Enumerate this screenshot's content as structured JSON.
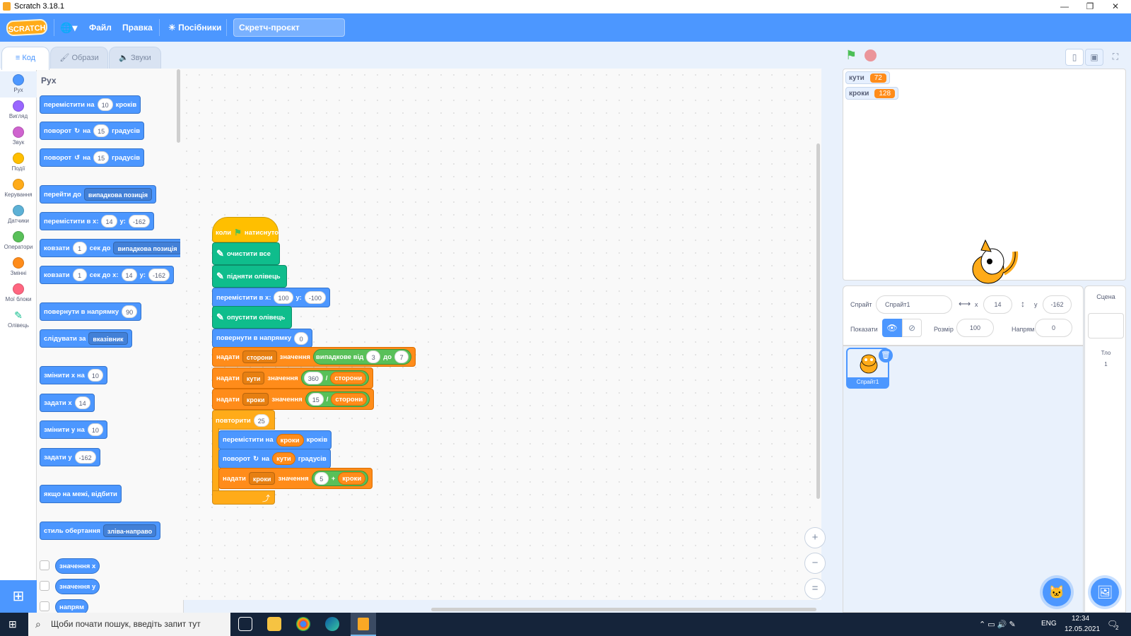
{
  "window": {
    "title": "Scratch 3.18.1",
    "minimize": "—",
    "restore": "❐",
    "close": "✕"
  },
  "menubar": {
    "logo": "SCRATCH",
    "language_icon": "🌐▾",
    "file": "Файл",
    "edit": "Правка",
    "tutorials": "Посібники",
    "project_title": "Скретч-проєкт"
  },
  "tabs": {
    "code": "Код",
    "costumes": "Образи",
    "sounds": "Звуки"
  },
  "categories": [
    {
      "label": "Рух",
      "color": "#4c97ff"
    },
    {
      "label": "Вигляд",
      "color": "#9966ff"
    },
    {
      "label": "Звук",
      "color": "#cf63cf"
    },
    {
      "label": "Події",
      "color": "#ffbf00"
    },
    {
      "label": "Керування",
      "color": "#ffab19"
    },
    {
      "label": "Датчики",
      "color": "#5cb1d6"
    },
    {
      "label": "Оператори",
      "color": "#59c059"
    },
    {
      "label": "Змінні",
      "color": "#ff8c1a"
    },
    {
      "label": "Мої блоки",
      "color": "#ff6680"
    },
    {
      "label": "Олівець",
      "color": "#0fbd8c"
    }
  ],
  "palette": {
    "title": "Рух",
    "move": {
      "a": "перемістити на",
      "n": "10",
      "b": "кроків"
    },
    "turn_cw": {
      "a": "поворот",
      "b": "на",
      "n": "15",
      "c": "градусів"
    },
    "turn_ccw": {
      "a": "поворот",
      "b": "на",
      "n": "15",
      "c": "градусів"
    },
    "goto": {
      "a": "перейти до",
      "dd": "випадкова позиція"
    },
    "goto_xy": {
      "a": "перемістити в x:",
      "x": "14",
      "b": "y:",
      "y": "-162"
    },
    "glide": {
      "a": "ковзати",
      "n": "1",
      "b": "сек до",
      "dd": "випадкова позиція"
    },
    "glide_xy": {
      "a": "ковзати",
      "n": "1",
      "b": "сек до x:",
      "x": "14",
      "c": "y:",
      "y": "-162"
    },
    "point_dir": {
      "a": "повернути в напрямку",
      "n": "90"
    },
    "point_towards": {
      "a": "слідувати за",
      "dd": "вказівник"
    },
    "change_x": {
      "a": "змінити х на",
      "n": "10"
    },
    "set_x": {
      "a": "задати х",
      "n": "14"
    },
    "change_y": {
      "a": "змінити у на",
      "n": "10"
    },
    "set_y": {
      "a": "задати у",
      "n": "-162"
    },
    "bounce": "якщо на межі, відбити",
    "rotation_style": {
      "a": "стиль обертання",
      "dd": "зліва-направо"
    },
    "rep_x": "значення x",
    "rep_y": "значення y",
    "rep_dir": "напрям"
  },
  "script": {
    "hat": {
      "a": "коли",
      "b": "натиснуто"
    },
    "clear": "очистити все",
    "pen_up": "підняти олівець",
    "goto_xy": {
      "a": "перемістити в x:",
      "x": "100",
      "b": "у:",
      "y": "-100"
    },
    "pen_down": "опустити олівець",
    "point_dir": {
      "a": "повернути в напрямку",
      "n": "0"
    },
    "set_sides": {
      "a": "надати",
      "dd": "сторони",
      "b": "значення",
      "c": "випадкове від",
      "n1": "3",
      "d": "до",
      "n2": "7"
    },
    "set_angles": {
      "a": "надати",
      "dd": "кути",
      "b": "значення",
      "n": "360",
      "op": "/",
      "v": "сторони"
    },
    "set_steps": {
      "a": "надати",
      "dd": "кроки",
      "b": "значення",
      "n": "15",
      "op": "/",
      "v": "сторони"
    },
    "repeat": {
      "a": "повторити",
      "n": "25"
    },
    "inner_move": {
      "a": "перемістити на",
      "v": "кроки",
      "b": "кроків"
    },
    "inner_turn": {
      "a": "поворот",
      "b": "на",
      "v": "кути",
      "c": "градусів"
    },
    "inner_set": {
      "a": "надати",
      "dd": "кроки",
      "b": "значення",
      "n": "5",
      "op": "+",
      "v": "кроки"
    }
  },
  "zoom": {
    "in": "+",
    "out": "−",
    "reset": "="
  },
  "stage_monitors": [
    {
      "label": "кути",
      "value": "72"
    },
    {
      "label": "кроки",
      "value": "128"
    }
  ],
  "sprite_info": {
    "sprite_label": "Спрайт",
    "sprite_name": "Спрайт1",
    "x_label": "x",
    "x": "14",
    "y_label": "y",
    "y": "-162",
    "show_label": "Показати",
    "size_label": "Розмір",
    "size": "100",
    "direction_label": "Напрям",
    "direction": "0"
  },
  "sprite_tile": {
    "name": "Спрайт1"
  },
  "stage_panel": {
    "title": "Сцена",
    "backdrop_label": "Тло",
    "backdrop_count": "1"
  },
  "taskbar": {
    "search_placeholder": "Щоби почати пошук, введіть запит тут",
    "lang": "ENG",
    "time": "12:34",
    "date": "12.05.2021",
    "notif": "2"
  }
}
